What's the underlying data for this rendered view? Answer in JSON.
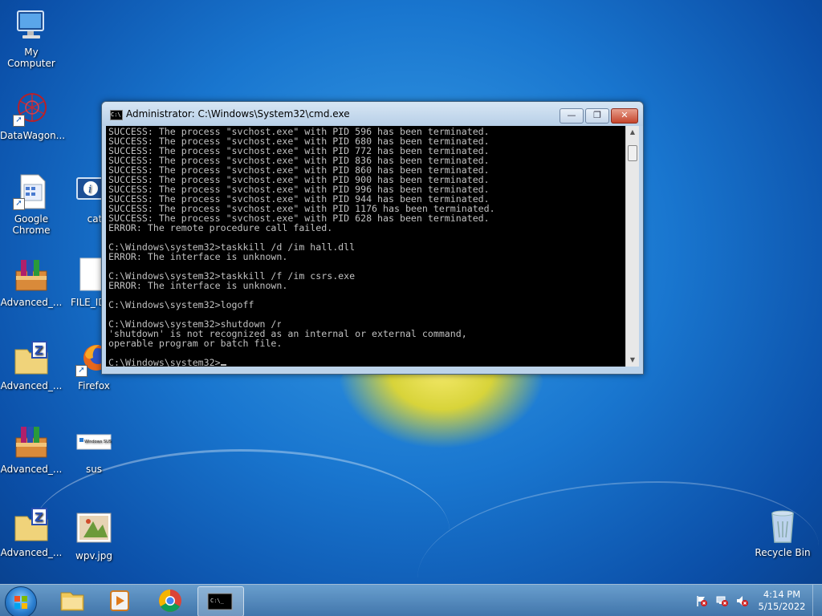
{
  "desktop": {
    "icons": [
      {
        "label": "My Computer"
      },
      {
        "label": "DataWagon..."
      },
      {
        "label": "Google Chrome"
      },
      {
        "label": "cat"
      },
      {
        "label": "Advanced_..."
      },
      {
        "label": "FILE_ID"
      },
      {
        "label": "Advanced_..."
      },
      {
        "label": "Firefox"
      },
      {
        "label": "Advanced_..."
      },
      {
        "label": "sus"
      },
      {
        "label": "Advanced_..."
      },
      {
        "label": "wpv.jpg"
      },
      {
        "label": "Recycle Bin"
      }
    ],
    "sus_thumbnail_text": "Windows SUS"
  },
  "cmd_window": {
    "title": "Administrator: C:\\Windows\\System32\\cmd.exe",
    "icon_text": "C:\\",
    "buttons": {
      "minimize": "—",
      "maximize": "❐",
      "close": "✕"
    },
    "lines": [
      "SUCCESS: The process \"svchost.exe\" with PID 596 has been terminated.",
      "SUCCESS: The process \"svchost.exe\" with PID 680 has been terminated.",
      "SUCCESS: The process \"svchost.exe\" with PID 772 has been terminated.",
      "SUCCESS: The process \"svchost.exe\" with PID 836 has been terminated.",
      "SUCCESS: The process \"svchost.exe\" with PID 860 has been terminated.",
      "SUCCESS: The process \"svchost.exe\" with PID 900 has been terminated.",
      "SUCCESS: The process \"svchost.exe\" with PID 996 has been terminated.",
      "SUCCESS: The process \"svchost.exe\" with PID 944 has been terminated.",
      "SUCCESS: The process \"svchost.exe\" with PID 1176 has been terminated.",
      "SUCCESS: The process \"svchost.exe\" with PID 628 has been terminated.",
      "ERROR: The remote procedure call failed.",
      "",
      "C:\\Windows\\system32>taskkill /d /im hall.dll",
      "ERROR: The interface is unknown.",
      "",
      "C:\\Windows\\system32>taskkill /f /im csrs.exe",
      "ERROR: The interface is unknown.",
      "",
      "C:\\Windows\\system32>logoff",
      "",
      "C:\\Windows\\system32>shutdown /r",
      "'shutdown' is not recognized as an internal or external command,",
      "operable program or batch file.",
      "",
      "C:\\Windows\\system32>"
    ]
  },
  "taskbar": {
    "apps": [
      "Windows Explorer",
      "Windows Media Player",
      "Google Chrome",
      "Command Prompt"
    ],
    "clock": {
      "time": "4:14 PM",
      "date": "5/15/2022"
    }
  },
  "colors": {
    "console_bg": "#000000",
    "console_fg": "#c0c0c0",
    "close_button": "#c5452c"
  }
}
